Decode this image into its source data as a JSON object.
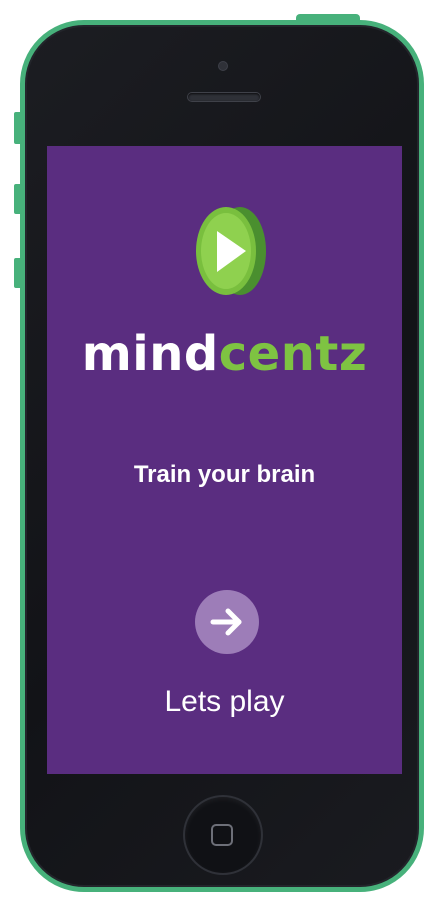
{
  "app": {
    "brand_primary": "mind",
    "brand_secondary": "centz",
    "tagline": "Train your brain",
    "cta_label": "Lets play"
  },
  "colors": {
    "screen_background": "#5a2d80",
    "brand_green": "#7ec342",
    "button_fill": "#9d7db8",
    "phone_frame": "#47b17b",
    "phone_body": "#121317"
  },
  "icons": {
    "logo": "play-coin-icon",
    "cta": "arrow-right-icon"
  }
}
